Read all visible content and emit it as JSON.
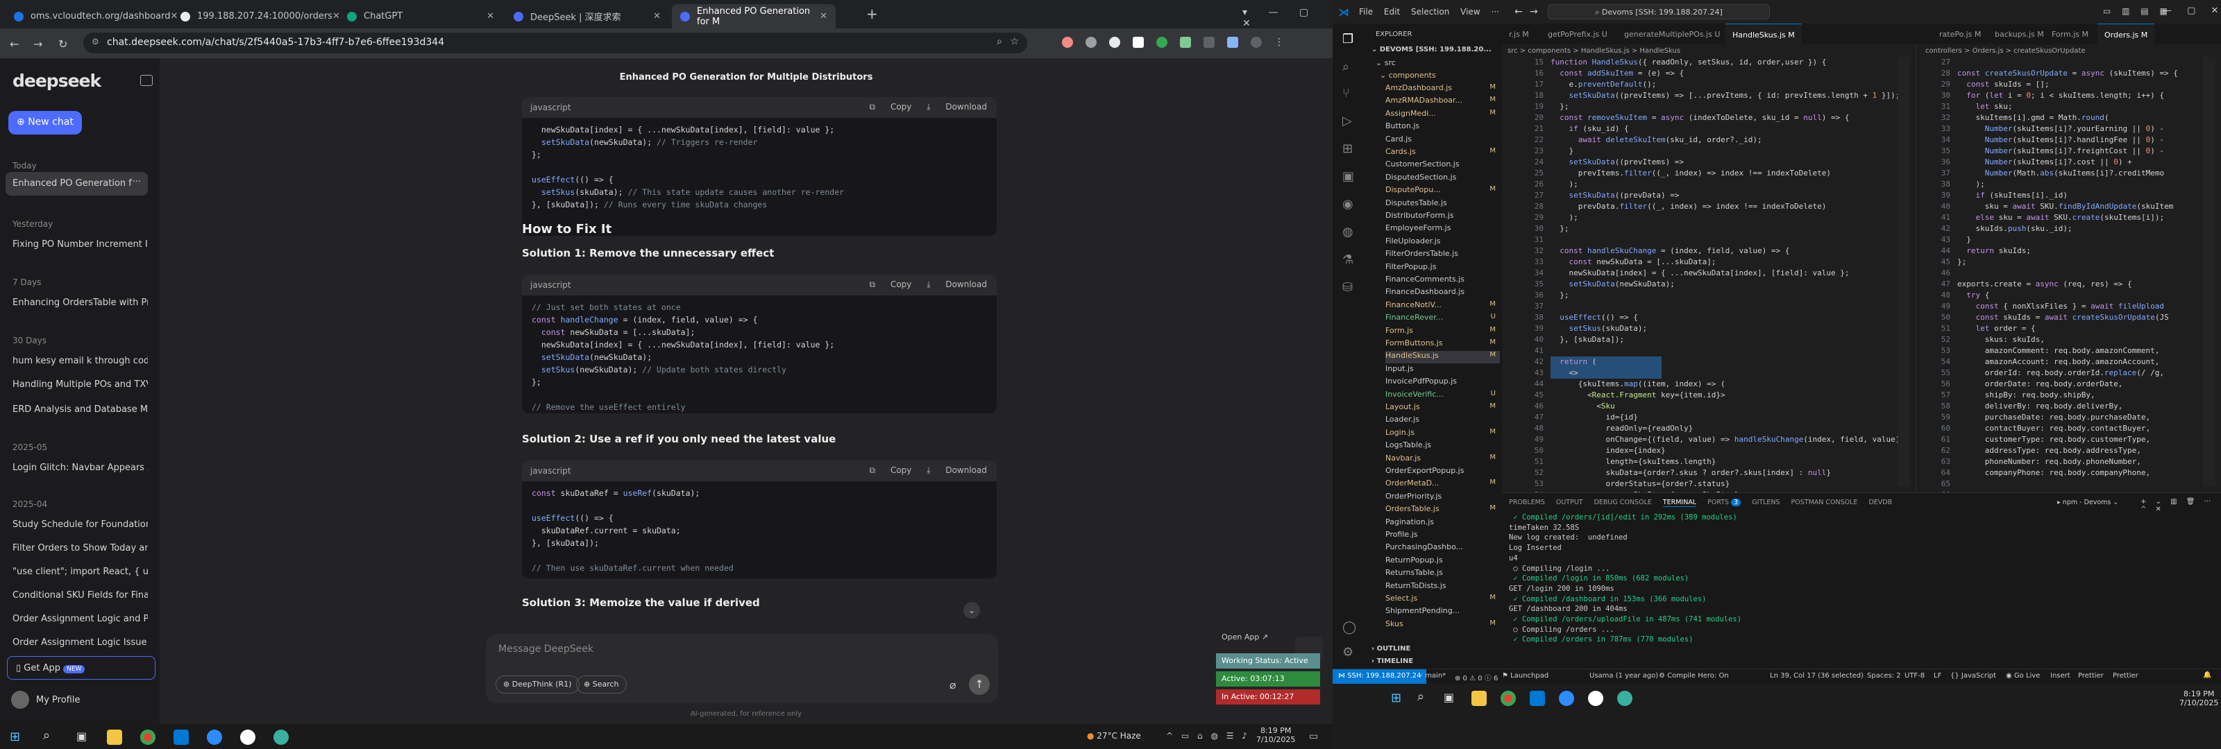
{
  "browser": {
    "tabs": [
      {
        "title": "oms.vcloudtech.org/dashboard",
        "color": "#1a73e8"
      },
      {
        "title": "199.188.207.24:10000/orders",
        "color": "#e8eaed"
      },
      {
        "title": "ChatGPT",
        "color": "#10a37f"
      },
      {
        "title": "DeepSeek | 深度求索",
        "color": "#4d6bfe"
      },
      {
        "title": "Enhanced PO Generation for M",
        "color": "#4d6bfe"
      }
    ],
    "url": "chat.deepseek.com/a/chat/s/2f5440a5-17b3-4ff7-b7e6-6ffee193d344"
  },
  "deepseek": {
    "logo": "deepseek",
    "new_chat": "New chat",
    "groups": [
      {
        "heading": "Today",
        "items": [
          "Enhanced PO Generation f"
        ]
      },
      {
        "heading": "Yesterday",
        "items": [
          "Fixing PO Number Increment Iss"
        ]
      },
      {
        "heading": "7 Days",
        "items": [
          "Enhancing OrdersTable with Pro"
        ]
      },
      {
        "heading": "30 Days",
        "items": [
          "hum kesy email k through code",
          "Handling Multiple POs and TXVi",
          "ERD Analysis and Database Mo"
        ]
      },
      {
        "heading": "2025-05",
        "items": [
          "Login Glitch: Navbar Appears Af"
        ]
      },
      {
        "heading": "2025-04",
        "items": [
          "Study Schedule for Foundation",
          "Filter Orders to Show Today and",
          "\"use client\"; import React, { us",
          "Conditional SKU Fields for Finan",
          "Order Assignment Logic and Pri",
          "Order Assignment Logic Issue w"
        ]
      }
    ],
    "get_app": "Get App",
    "new_badge": "NEW",
    "profile": "My Profile",
    "chat_title": "Enhanced PO Generation for Multiple Distributors",
    "code_lang": "javascript",
    "copy": "Copy",
    "download": "Download",
    "heading_fix": "How to Fix It",
    "sol1": "Solution 1: Remove the unnecessary effect",
    "sol2": "Solution 2: Use a ref if you only need the latest value",
    "sol3": "Solution 3: Memoize the value if derived",
    "input_placeholder": "Message DeepSeek",
    "deepthink": "DeepThink (R1)",
    "search": "Search",
    "disclaimer": "AI-generated, for reference only",
    "open_app": "Open App",
    "working_status": "Working Status: Active",
    "active_time": "Active: 03:07:13",
    "inactive_time": "In Active: 00:12:27"
  },
  "win_taskbar": {
    "weather": "27°C  Haze",
    "time": "8:19 PM",
    "date": "7/10/2025"
  },
  "vscode": {
    "menu": [
      "File",
      "Edit",
      "Selection",
      "View"
    ],
    "search": "Devoms [SSH: 199.188.207.24]",
    "explorer_title": "EXPLORER",
    "root": "DEVOMS [SSH: 199.188.20...",
    "folder": "components",
    "files": [
      [
        "AmzDashboard.js",
        "M"
      ],
      [
        "AmzRMADashboar...",
        "M"
      ],
      [
        "AssignMedi...",
        "M"
      ],
      [
        "Button.js",
        ""
      ],
      [
        "Card.js",
        ""
      ],
      [
        "Cards.js",
        "M"
      ],
      [
        "CustomerSection.js",
        ""
      ],
      [
        "DisputedSection.js",
        ""
      ],
      [
        "DisputePopu...",
        "M"
      ],
      [
        "DisputesTable.js",
        ""
      ],
      [
        "DistributorForm.js",
        ""
      ],
      [
        "EmployeeForm.js",
        ""
      ],
      [
        "FileUploader.js",
        ""
      ],
      [
        "FilterOrdersTable.js",
        ""
      ],
      [
        "FilterPopup.js",
        ""
      ],
      [
        "FinanceComments.js",
        ""
      ],
      [
        "FinanceDashboard.js",
        ""
      ],
      [
        "FinanceNotiV...",
        "M"
      ],
      [
        "FinanceRever...",
        "U"
      ],
      [
        "Form.js",
        "M"
      ],
      [
        "FormButtons.js",
        "M"
      ],
      [
        "HandleSkus.js",
        "M"
      ],
      [
        "Input.js",
        ""
      ],
      [
        "InvoicePdfPopup.js",
        ""
      ],
      [
        "InvoiceVerific...",
        "U"
      ],
      [
        "Layout.js",
        "M"
      ],
      [
        "Loader.js",
        ""
      ],
      [
        "Login.js",
        "M"
      ],
      [
        "LogsTable.js",
        ""
      ],
      [
        "Navbar.js",
        "M"
      ],
      [
        "OrderExportPopup.js",
        ""
      ],
      [
        "OrderMetaD...",
        "M"
      ],
      [
        "OrderPriority.js",
        ""
      ],
      [
        "OrdersTable.js",
        "M"
      ],
      [
        "Pagination.js",
        ""
      ],
      [
        "Profile.js",
        ""
      ],
      [
        "PurchasingDashbo...",
        ""
      ],
      [
        "ReturnPopup.js",
        ""
      ],
      [
        "ReturnsTable.js",
        ""
      ],
      [
        "ReturnToDists.js",
        ""
      ],
      [
        "Select.js",
        "M"
      ],
      [
        "ShipmentPending...",
        ""
      ],
      [
        "Skus",
        "M"
      ]
    ],
    "outline": "OUTLINE",
    "timeline": "TIMELINE",
    "tabs_left": [
      "r.js M",
      "getPoPrefix.js U",
      "generateMultiplePOs.js U",
      "HandleSkus.js M"
    ],
    "tabs_right": [
      "ratePo.js M",
      "backups.js M",
      "Form.js M",
      "Orders.js M"
    ],
    "breadcrumb_left": "src > components > HandleSkus.js > HandleSkus",
    "breadcrumb_right": "controllers > Orders.js > createSkusOrUpdate",
    "panel_tabs": [
      "PROBLEMS",
      "OUTPUT",
      "DEBUG CONSOLE",
      "TERMINAL",
      "PORTS",
      "GITLENS",
      "POSTMAN CONSOLE",
      "DEVDB"
    ],
    "ports_count": "3",
    "terminal_label": "npm - Devoms",
    "terminal": [
      " ✓ Compiled /orders/[id]/edit in 292ms (389 modules)",
      "timeTaken 32.58S",
      "New log created:  undefined",
      "Log Inserted",
      "u4",
      " ○ Compiling /login ...",
      " ✓ Compiled /login in 850ms (682 modules)",
      "GET /login 200 in 1090ms",
      " ✓ Compiled /dashboard in 153ms (366 modules)",
      "GET /dashboard 200 in 404ms",
      " ✓ Compiled /orders/uploadFile in 487ms (741 modules)",
      " ○ Compiling /orders ...",
      " ✓ Compiled /orders in 787ms (770 modules)"
    ],
    "status_ssh": "SSH: 199.188.207.24",
    "status_branch": "main*",
    "status_errors": "⊗ 0  ⚠ 0  ⓘ 6",
    "status_launch": "Launchpad",
    "status_git": "Usama (1 year ago)",
    "status_compile": "Compile Hero: On",
    "status_pos": "Ln 39, Col 17 (36 selected)",
    "status_spaces": "Spaces: 2",
    "status_enc": "UTF-8",
    "status_eol": "LF",
    "status_lang": "{} JavaScript",
    "status_live": "Go Live",
    "status_insert": "Insert",
    "status_prettier": "Prettier"
  }
}
